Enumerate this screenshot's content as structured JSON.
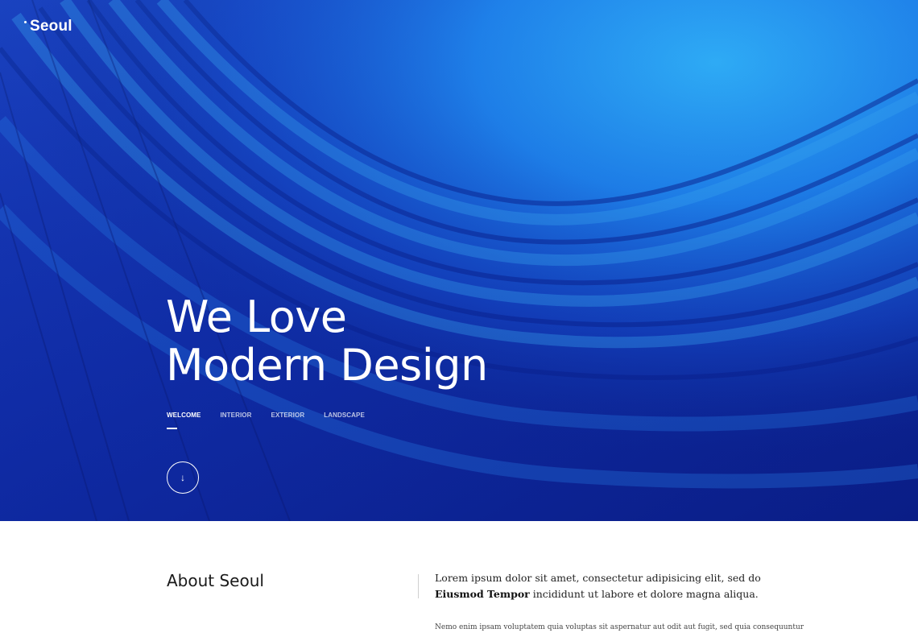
{
  "brand": {
    "name": "Seoul"
  },
  "hero": {
    "headline_line1": "We Love",
    "headline_line2": "Modern Design",
    "tabs": [
      {
        "label": "WELCOME",
        "active": true
      },
      {
        "label": "INTERIOR",
        "active": false
      },
      {
        "label": "EXTERIOR",
        "active": false
      },
      {
        "label": "LANDSCAPE",
        "active": false
      }
    ],
    "scroll_icon": "arrow-down-icon",
    "scroll_glyph": "↓"
  },
  "about": {
    "title": "About Seoul",
    "lead_text_1": "Lorem ipsum dolor sit amet, consectetur adipisicing elit, sed do ",
    "lead_bold": "Eiusmod Tempor",
    "lead_text_2": " incididunt ut labore et dolore magna aliqua.",
    "body": "Nemo enim ipsam voluptatem quia voluptas sit aspernatur aut odit aut fugit, sed quia consequuntur magni"
  },
  "colors": {
    "hero_dark": "#0b1f8a",
    "hero_mid": "#1a5fe0",
    "hero_light": "#29a8f5",
    "text_dark": "#1a1a1a"
  }
}
